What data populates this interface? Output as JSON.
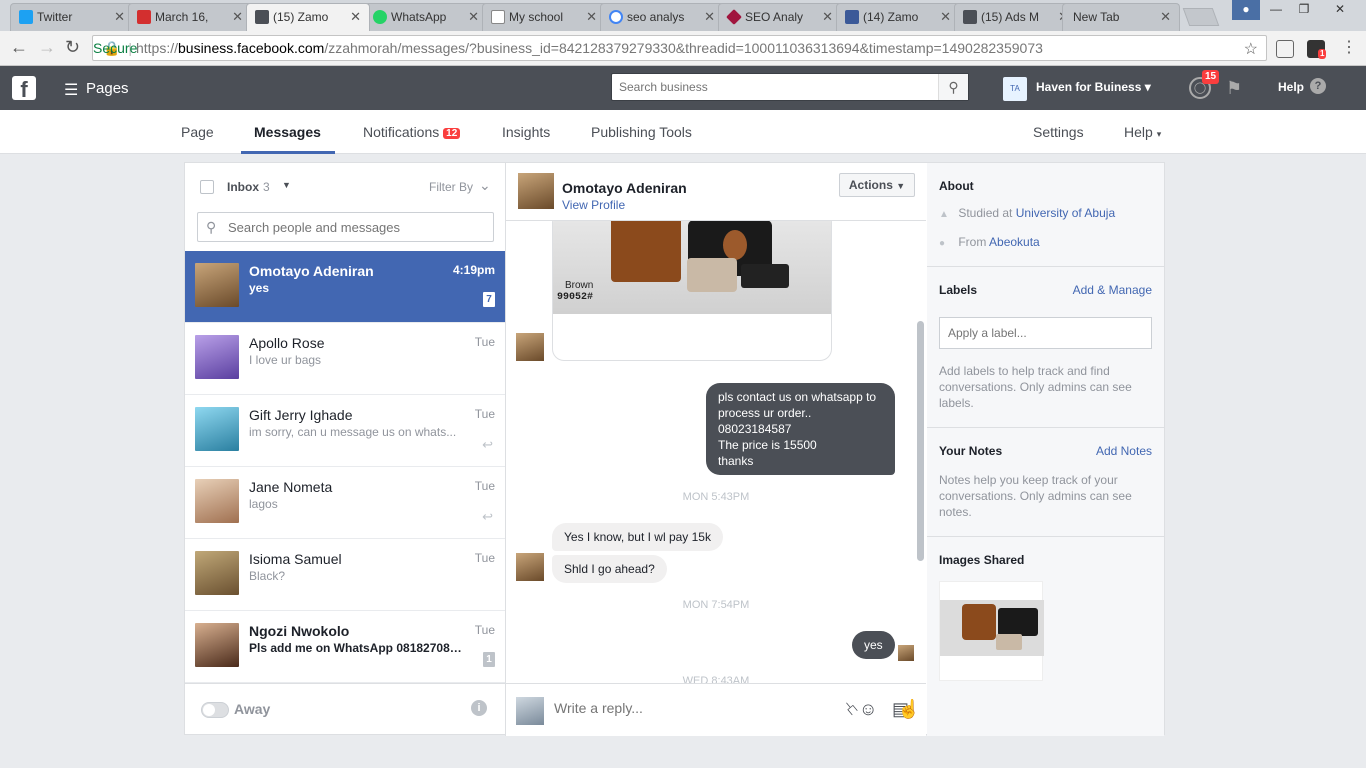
{
  "browser": {
    "tabs": [
      {
        "label": "Twitter",
        "color": "#1da1f2"
      },
      {
        "label": "March 16,",
        "color": "#d32f2f"
      },
      {
        "label": "(15) Zamo",
        "color": "#4b4f56"
      },
      {
        "label": "WhatsApp",
        "color": "#25d366"
      },
      {
        "label": "My school",
        "color": "#888888"
      },
      {
        "label": "seo analys",
        "color": "#4285f4"
      },
      {
        "label": "SEO Analy",
        "color": "#a0153e"
      },
      {
        "label": "(14) Zamo",
        "color": "#3b5998"
      },
      {
        "label": "(15) Ads M",
        "color": "#4b4f56"
      },
      {
        "label": "New Tab",
        "color": ""
      }
    ],
    "secure_label": "Secure",
    "url_scheme": "https://",
    "url_domain": "business.facebook.com",
    "url_rest": "/zzahmorah/messages/?business_id=842128379279330&threadid=100011036313694&timestamp=1490282359073",
    "ext_badge": "1"
  },
  "topbar": {
    "pages_label": "Pages",
    "search_placeholder": "Search business",
    "account_initials": "TA",
    "account_name": "Haven for Buiness",
    "notif_count": "15",
    "help_label": "Help"
  },
  "pagenav": {
    "page": "Page",
    "messages": "Messages",
    "notifications": "Notifications",
    "notifications_count": "12",
    "insights": "Insights",
    "publishing_tools": "Publishing Tools",
    "settings": "Settings",
    "help": "Help"
  },
  "inbox": {
    "label": "Inbox",
    "count": "3",
    "filter_label": "Filter By",
    "search_placeholder": "Search people and messages",
    "threads": [
      {
        "name": "Omotayo Adeniran",
        "snippet": "yes",
        "time": "4:19pm",
        "count": "7",
        "color": "#a67c52"
      },
      {
        "name": "Apollo Rose",
        "snippet": "I love ur bags",
        "time": "Tue",
        "color": "#7a5fc0"
      },
      {
        "name": "Gift Jerry Ighade",
        "snippet": "im sorry, can u message us on whats...",
        "time": "Tue",
        "color": "#3aa7c9"
      },
      {
        "name": "Jane Nometa",
        "snippet": "lagos",
        "time": "Tue",
        "color": "#c9a27a"
      },
      {
        "name": "Isioma Samuel",
        "snippet": "Black?",
        "time": "Tue",
        "color": "#8a6a3a"
      },
      {
        "name": "Ngozi Nwokolo",
        "snippet": "Pls add me on WhatsApp 081827087...",
        "time": "Tue",
        "count": "1",
        "color": "#5a3a2a"
      }
    ],
    "away_label": "Away"
  },
  "conversation": {
    "name": "Omotayo Adeniran",
    "view_profile": "View Profile",
    "actions_label": "Actions",
    "image_text_brown": "Brown",
    "image_text_code": "99052#",
    "outgoing_1": [
      "pls contact us on whatsapp to",
      "process ur order..",
      "08023184587",
      "The price is 15500",
      "thanks"
    ],
    "date_1": "MON 5:43PM",
    "incoming_1": "Yes I know, but I wl pay 15k",
    "incoming_2": "Shld I go ahead?",
    "date_2": "MON 7:54PM",
    "outgoing_2": "yes",
    "date_3": "WED 8:43AM",
    "reply_placeholder": "Write a reply..."
  },
  "about": {
    "title": "About",
    "studied_prefix": "Studied at",
    "studied_link": "University of Abuja",
    "from_prefix": "From",
    "from_link": "Abeokuta",
    "labels_title": "Labels",
    "labels_link": "Add & Manage",
    "label_placeholder": "Apply a label...",
    "labels_help": "Add labels to help track and find conversations. Only admins can see labels.",
    "notes_title": "Your Notes",
    "notes_link": "Add Notes",
    "notes_help": "Notes help you keep track of your conversations. Only admins can see notes.",
    "images_title": "Images Shared"
  }
}
